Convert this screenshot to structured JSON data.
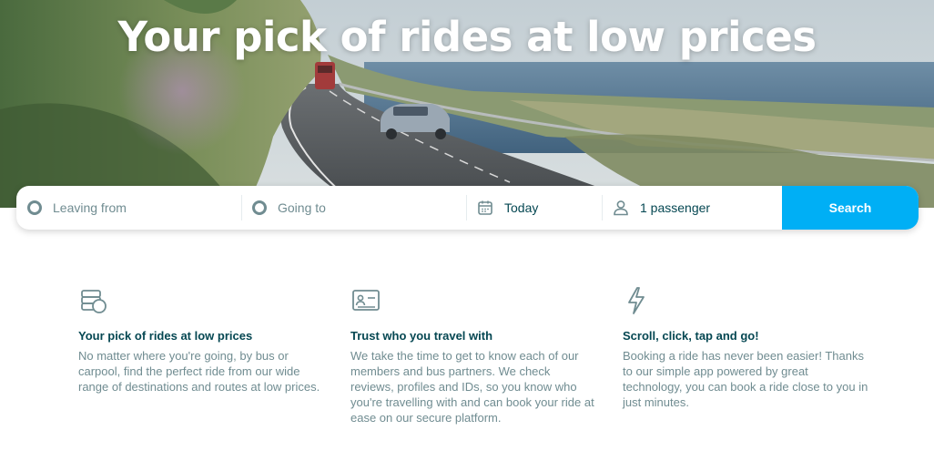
{
  "hero": {
    "title": "Your pick of rides at low prices"
  },
  "search": {
    "leaving_placeholder": "Leaving from",
    "going_placeholder": "Going to",
    "date_value": "Today",
    "passengers_value": "1 passenger",
    "search_label": "Search",
    "accent_color": "#00aff5"
  },
  "features": [
    {
      "icon": "money-coins-icon",
      "title": "Your pick of rides at low prices",
      "text": "No matter where you're going, by bus or carpool, find the perfect ride from our wide range of destinations and routes at low prices."
    },
    {
      "icon": "id-card-icon",
      "title": "Trust who you travel with",
      "text": "We take the time to get to know each of our members and bus partners. We check reviews, profiles and IDs, so you know who you're travelling with and can book your ride at ease on our secure platform."
    },
    {
      "icon": "lightning-bolt-icon",
      "title": "Scroll, click, tap and go!",
      "text": "Booking a ride has never been easier! Thanks to our simple app powered by great technology, you can book a ride close to you in just minutes."
    }
  ]
}
